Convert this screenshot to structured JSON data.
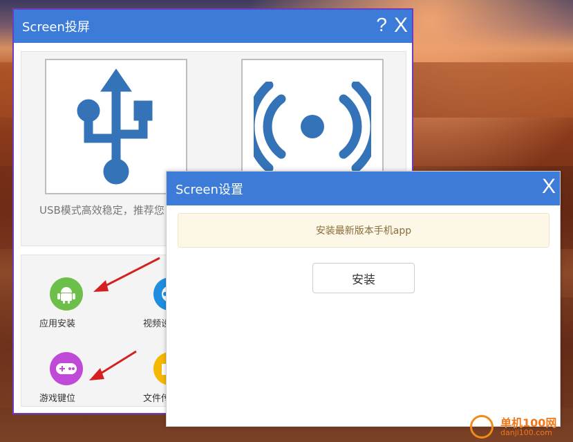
{
  "main_window": {
    "title": "Screen投屏",
    "help_label": "?",
    "close_label": "X",
    "usb_description": "USB模式高效稳定，推荐您"
  },
  "tools": [
    {
      "label": "应用安装",
      "icon": "android-icon",
      "color": "#6cc04a"
    },
    {
      "label": "视频设",
      "icon": "film-reel-icon",
      "color": "#1f8ee0"
    },
    {
      "label": "游戏键位",
      "icon": "gamepad-icon",
      "color": "#c04ad8"
    },
    {
      "label": "文件传",
      "icon": "folder-icon",
      "color": "#f5b800"
    }
  ],
  "settings_dialog": {
    "title": "Screen设置",
    "close_label": "X",
    "notice": "安装最新版本手机app",
    "install_button": "安装"
  },
  "watermark": {
    "site": "单机100网",
    "url": "danji100.com"
  },
  "colors": {
    "titlebar": "#3d7bd8",
    "usb_icon": "#3473b8",
    "arrow": "#d42020"
  }
}
